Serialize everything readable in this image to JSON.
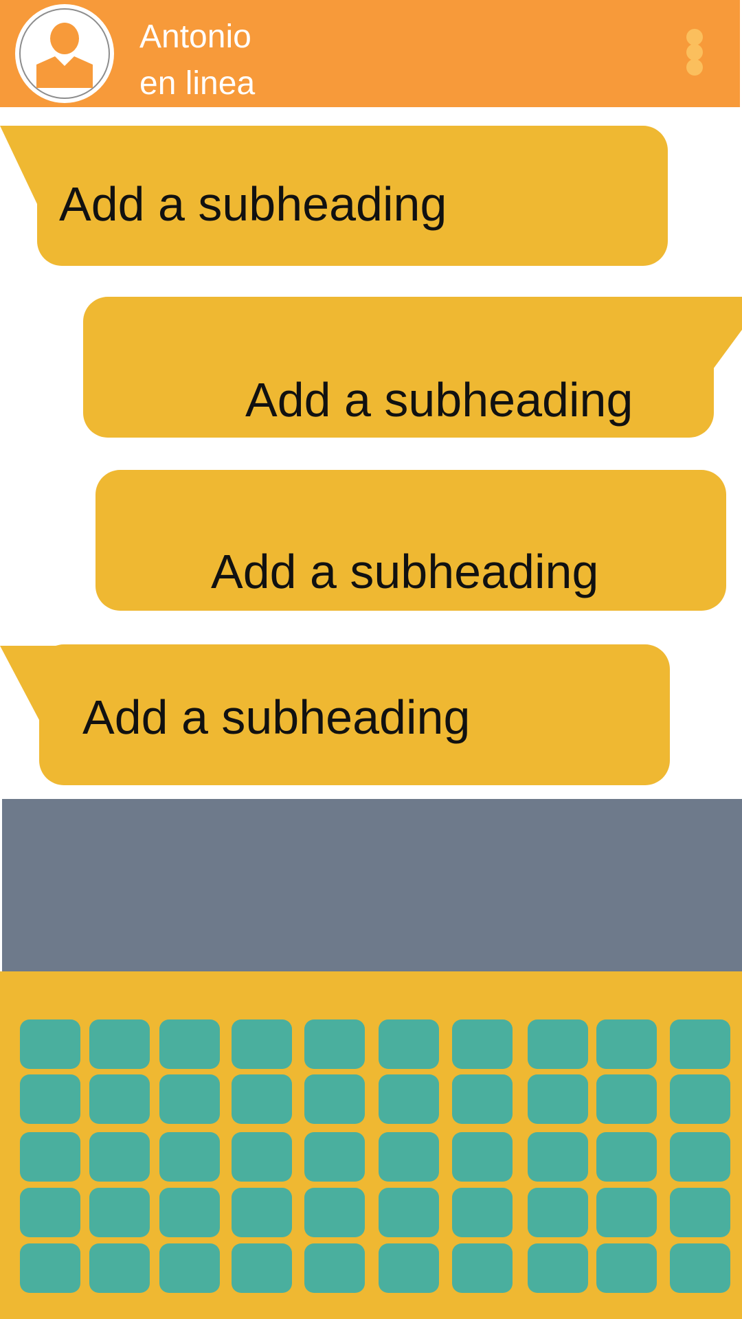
{
  "header": {
    "contact_name": "Antonio",
    "contact_status": "en linea",
    "background_color": "#f79a3a",
    "avatar_icon": "user-icon",
    "menu_icon": "more-vert-icon"
  },
  "messages": [
    {
      "text": "Add a subheading",
      "direction": "incoming"
    },
    {
      "text": "Add a subheading",
      "direction": "outgoing"
    },
    {
      "text": "Add a subheading",
      "direction": "outgoing"
    },
    {
      "text": "Add a subheading",
      "direction": "incoming"
    }
  ],
  "colors": {
    "bubble": "#efb832",
    "composer": "#6e7a8b",
    "keyboard": "#efb832",
    "key": "#4aaf9e"
  },
  "keyboard": {
    "rows": 5,
    "keys_per_row": 10
  }
}
